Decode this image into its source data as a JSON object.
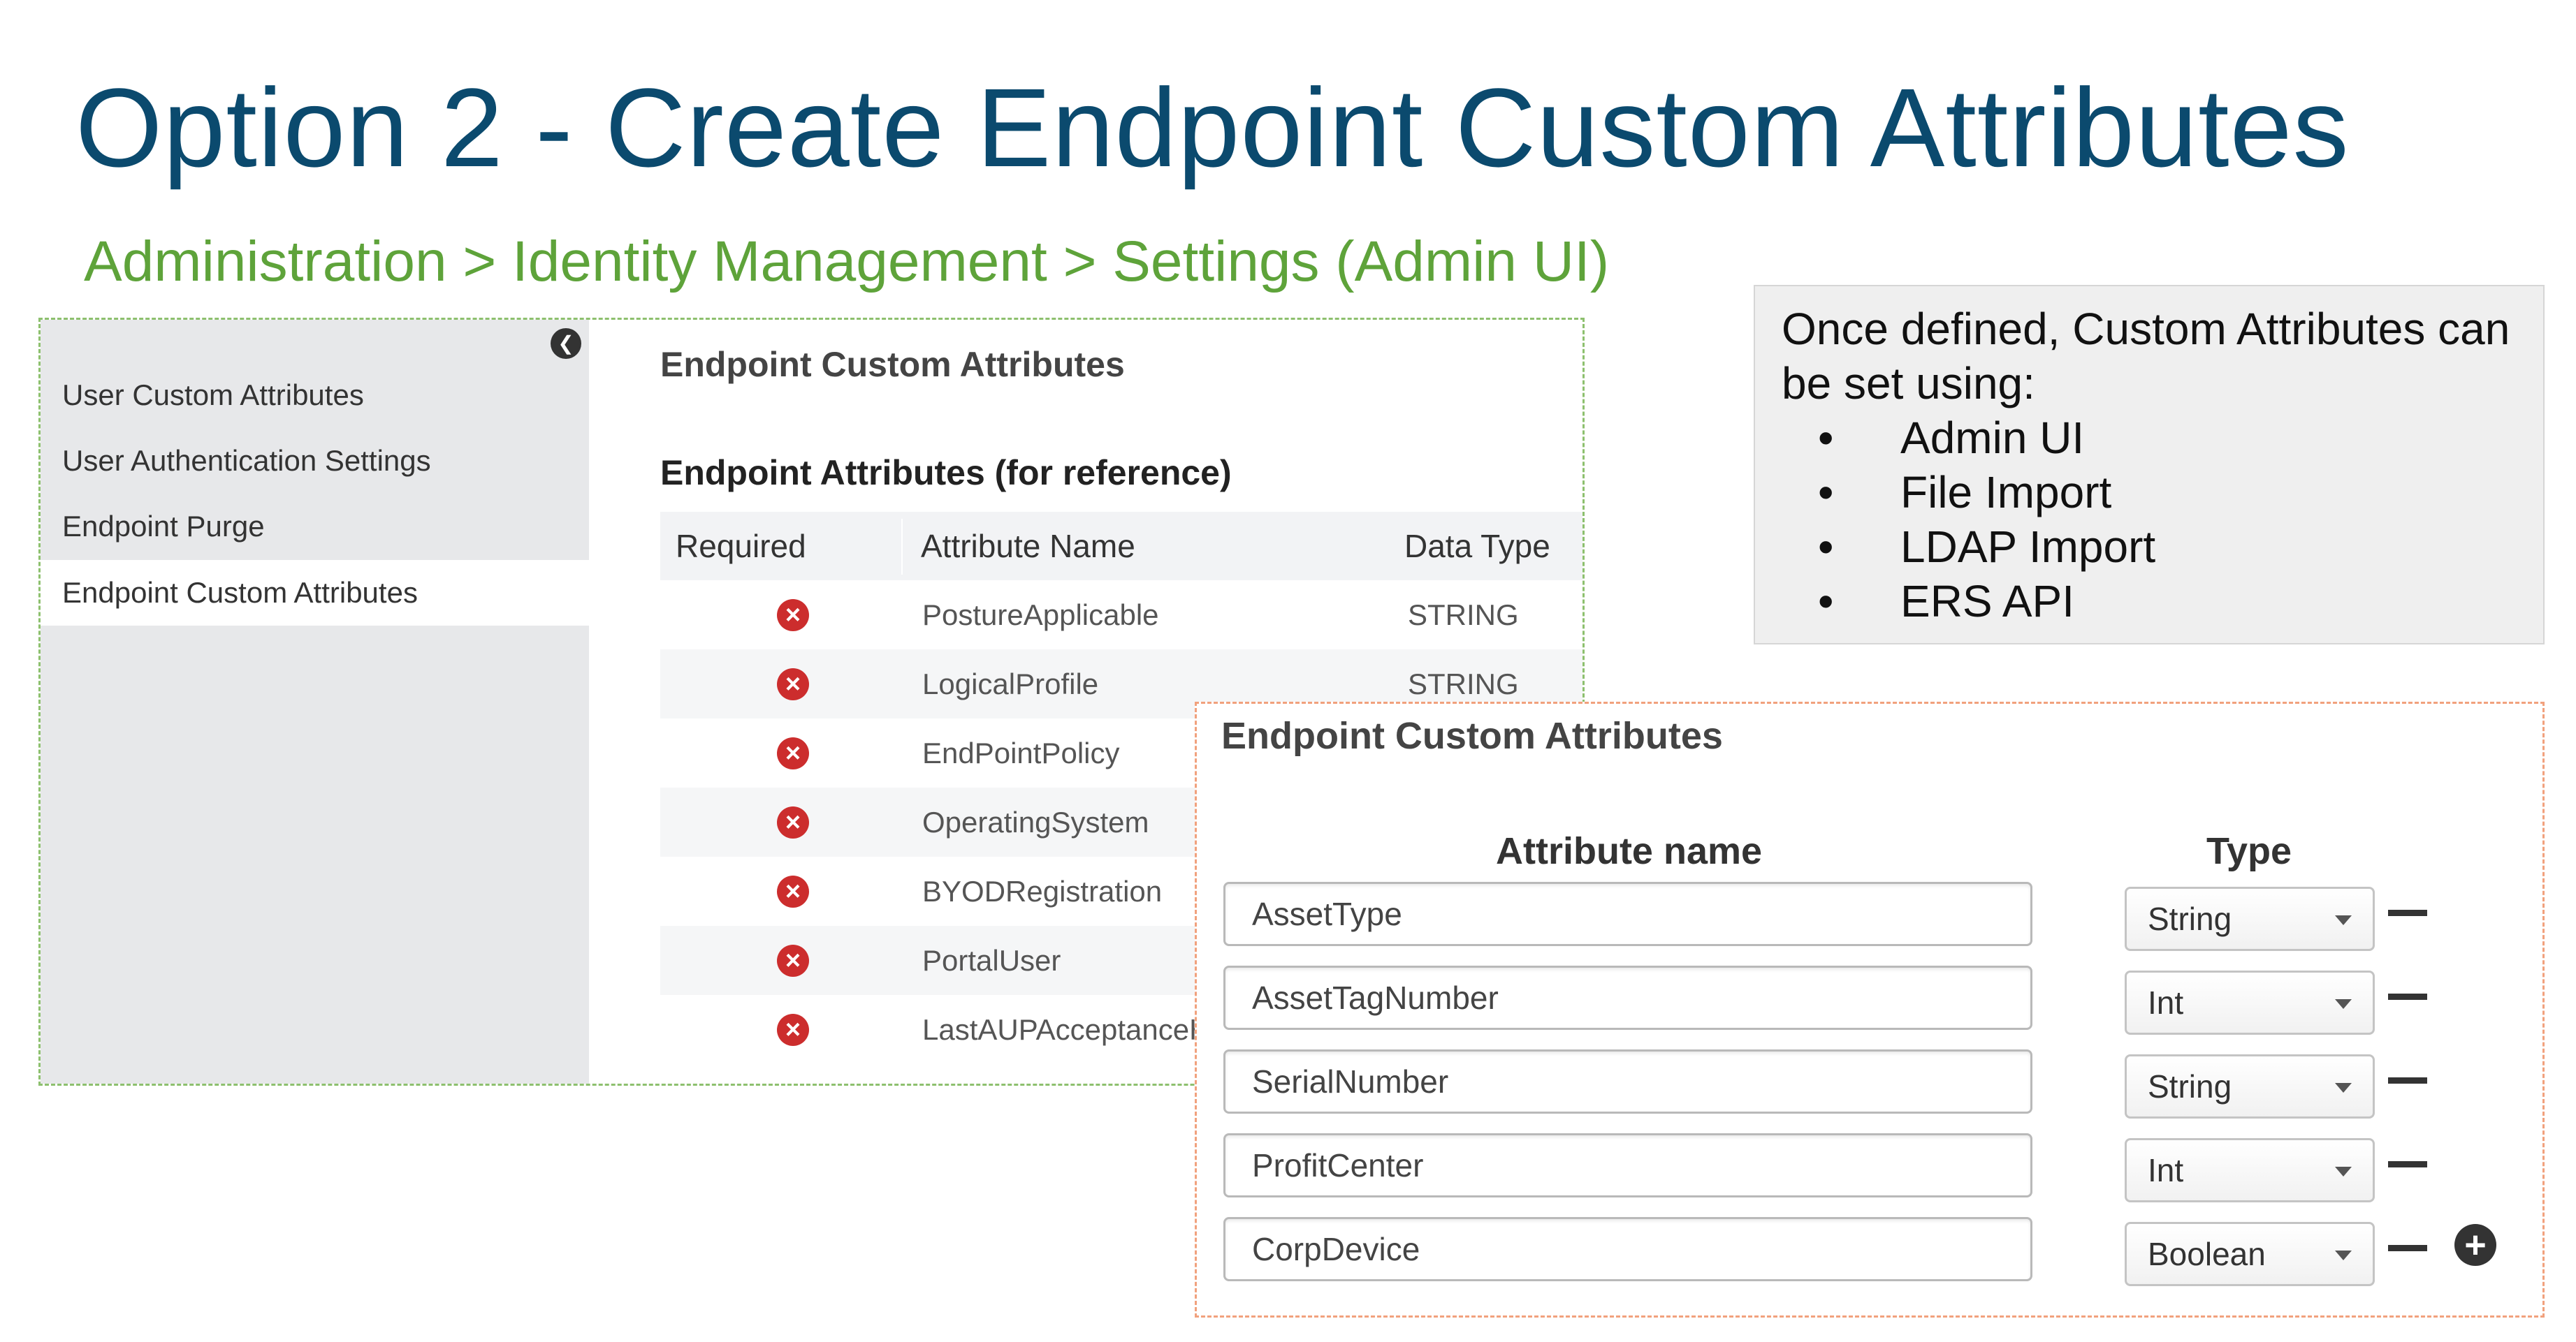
{
  "slide": {
    "title": "Option 2 - Create Endpoint Custom Attributes",
    "breadcrumb": "Administration > Identity Management > Settings (Admin UI)"
  },
  "admin": {
    "sidebar": {
      "items": [
        {
          "label": "User Custom Attributes"
        },
        {
          "label": "User Authentication Settings"
        },
        {
          "label": "Endpoint Purge"
        },
        {
          "label": "Endpoint Custom Attributes"
        }
      ],
      "collapse_glyph": "❮"
    },
    "heading": "Endpoint Custom Attributes",
    "ref_heading": "Endpoint Attributes (for reference)",
    "table": {
      "columns": [
        "Required",
        "Attribute Name",
        "Data Type"
      ],
      "rows": [
        {
          "name": "PostureApplicable",
          "type": "STRING"
        },
        {
          "name": "LogicalProfile",
          "type": "STRING"
        },
        {
          "name": "EndPointPolicy",
          "type": ""
        },
        {
          "name": "OperatingSystem",
          "type": ""
        },
        {
          "name": "BYODRegistration",
          "type": ""
        },
        {
          "name": "PortalUser",
          "type": ""
        },
        {
          "name": "LastAUPAcceptanceH",
          "type": ""
        }
      ],
      "required_glyph": "×"
    }
  },
  "info": {
    "intro": "Once defined, Custom Attributes can be set using:",
    "bullet_glyph": "•",
    "items": [
      "Admin UI",
      "File Import",
      "LDAP Import",
      "ERS API"
    ]
  },
  "editor": {
    "title": "Endpoint Custom Attributes",
    "col_attr": "Attribute name",
    "col_type": "Type",
    "rows": [
      {
        "name": "AssetType",
        "type": "String"
      },
      {
        "name": "AssetTagNumber",
        "type": "Int"
      },
      {
        "name": "SerialNumber",
        "type": "String"
      },
      {
        "name": "ProfitCenter",
        "type": "Int"
      },
      {
        "name": "CorpDevice",
        "type": "Boolean"
      }
    ],
    "add_glyph": "+"
  },
  "colors": {
    "title": "#0b4a6e",
    "breadcrumb": "#5ea33a",
    "required_icon": "#cc2d2d"
  }
}
